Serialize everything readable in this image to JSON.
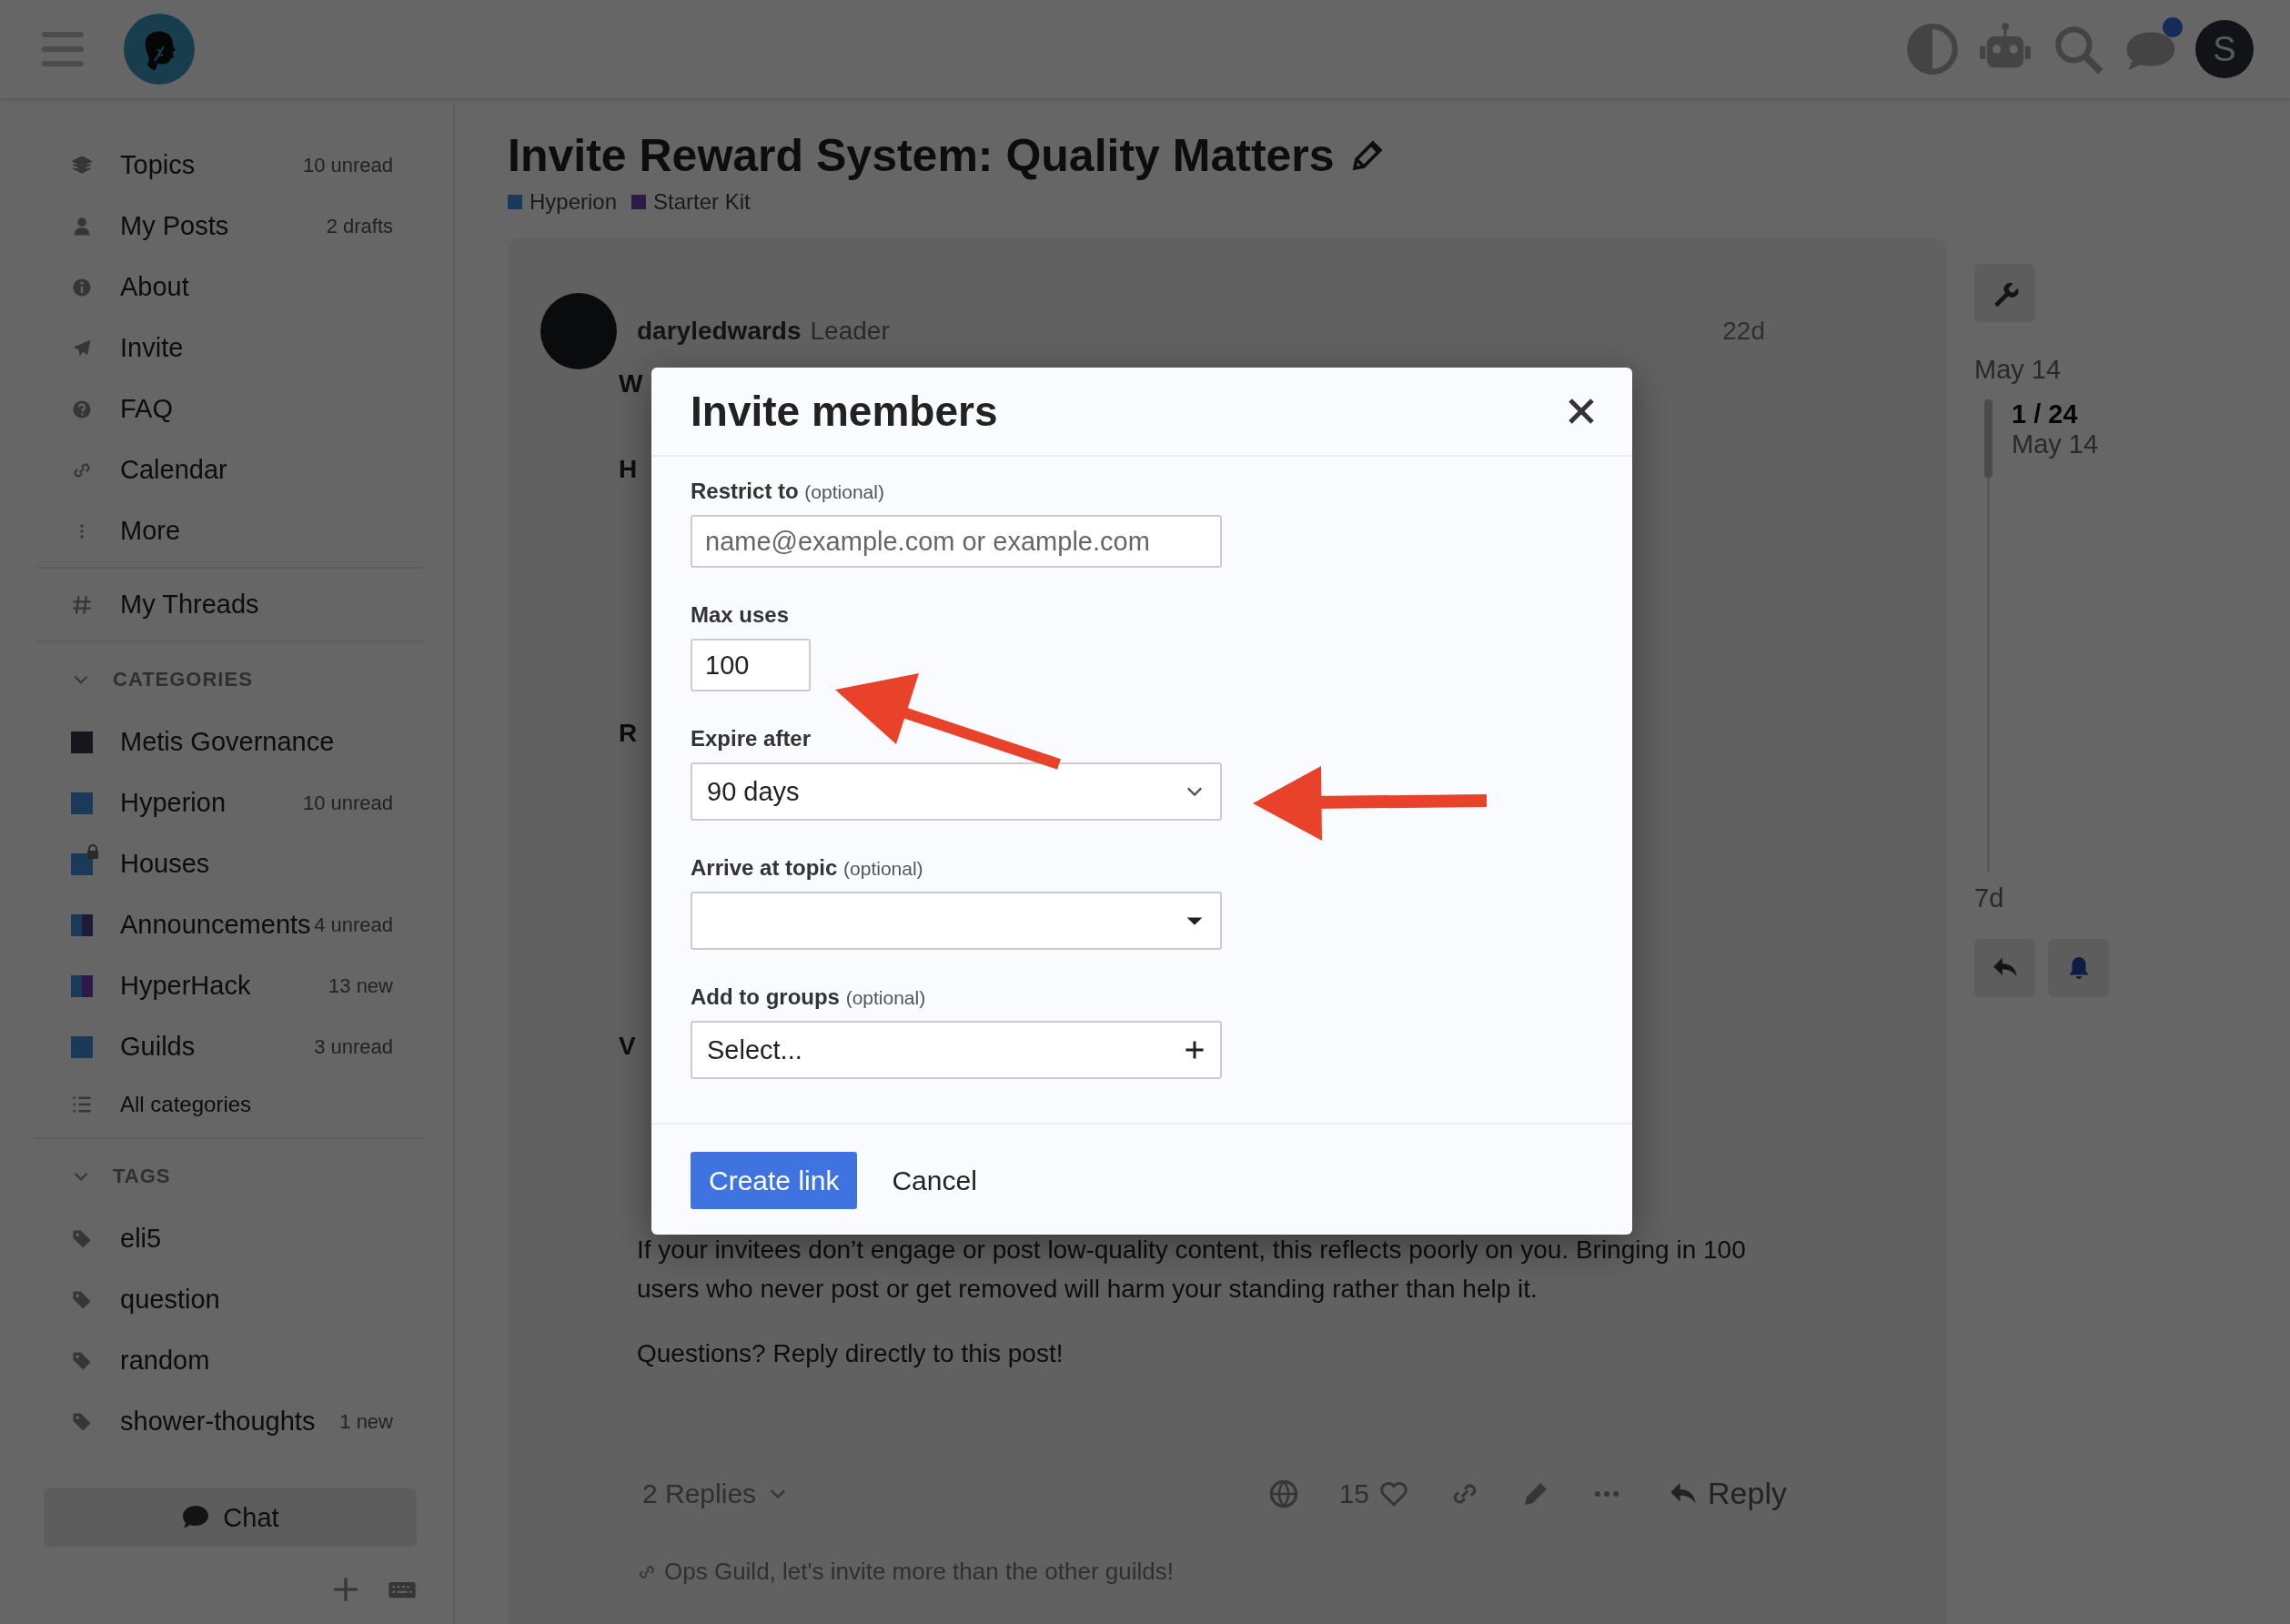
{
  "header": {
    "avatar_letter": "S",
    "chat_unread": true
  },
  "sidebar": {
    "nav": [
      {
        "label": "Topics",
        "count": "10 unread"
      },
      {
        "label": "My Posts",
        "count": "2 drafts"
      },
      {
        "label": "About"
      },
      {
        "label": "Invite"
      },
      {
        "label": "FAQ"
      },
      {
        "label": "Calendar"
      },
      {
        "label": "More"
      }
    ],
    "threads": {
      "label": "My Threads"
    },
    "categories": {
      "heading": "CATEGORIES",
      "expanded": true,
      "items": [
        {
          "label": "Metis Governance",
          "stripes": [
            {
              "color": "#16171d"
            }
          ],
          "locked": false
        },
        {
          "label": "Hyperion",
          "count": "10 unread",
          "stripes": [
            {
              "color": "#1b3a5a"
            }
          ],
          "locked": false
        },
        {
          "label": "Houses",
          "stripes": [
            {
              "color": "#1b3a5a"
            }
          ],
          "locked": true
        },
        {
          "label": "Announcements",
          "count": "4 unread",
          "stripes": [
            {
              "color": "#1b3a5a"
            },
            {
              "color": "#1e1a38"
            }
          ],
          "locked": false
        },
        {
          "label": "HyperHack",
          "count": "13 new",
          "stripes": [
            {
              "color": "#1b3a5a"
            },
            {
              "color": "#2c1a48"
            }
          ],
          "locked": false
        },
        {
          "label": "Guilds",
          "count": "3 unread",
          "stripes": [
            {
              "color": "#1b3a5a"
            }
          ],
          "locked": false
        }
      ],
      "all_label": "All categories"
    },
    "tags": {
      "heading": "TAGS",
      "expanded": true,
      "items": [
        {
          "label": "eli5"
        },
        {
          "label": "question"
        },
        {
          "label": "random"
        },
        {
          "label": "shower-thoughts",
          "count": "1 new"
        }
      ]
    },
    "chat_button": "Chat"
  },
  "topic": {
    "title": "Invite Reward System: Quality Matters",
    "tags": [
      {
        "label": "Hyperion",
        "color": "#1b3a5a"
      },
      {
        "label": "Starter Kit",
        "color": "#2c1a48"
      }
    ],
    "post": {
      "author": "daryledwards",
      "role": "Leader",
      "age": "22d",
      "fragments": [
        "W",
        "H",
        "R",
        "V"
      ],
      "paragraphs": [
        "If your invitees don’t engage or post low-quality content, this reflects poorly on you. Bringing in 100 users who never post or get removed will harm your standing rather than help it.",
        "Questions? Reply directly to this post!"
      ],
      "replies": "2 Replies",
      "likes": "15",
      "reply": "Reply",
      "link": "Ops Guild, let's invite more than the other guilds!"
    }
  },
  "timeline": {
    "start_date": "May 14",
    "position": "1 / 24",
    "position_date": "May 14",
    "end": "7d"
  },
  "modal": {
    "title": "Invite members",
    "fields": [
      {
        "kind": "text",
        "label": "Restrict to",
        "hint": "(optional)",
        "placeholder": "name@example.com or example.com"
      },
      {
        "kind": "number",
        "label": "Max uses",
        "value": "100"
      },
      {
        "kind": "select",
        "label": "Expire after",
        "value": "90 days"
      },
      {
        "kind": "combo",
        "label": "Arrive at topic",
        "hint": "(optional)"
      },
      {
        "kind": "multi",
        "label": "Add to groups",
        "hint": "(optional)",
        "value": "Select..."
      }
    ],
    "primary": "Create link",
    "cancel": "Cancel"
  }
}
